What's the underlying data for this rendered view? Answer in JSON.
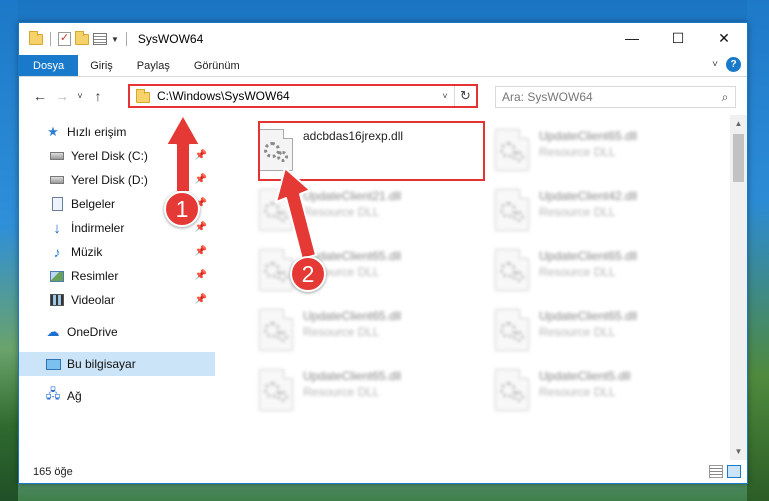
{
  "window": {
    "title": "SysWOW64",
    "controls": {
      "minimize": "—",
      "maximize": "☐",
      "close": "✕"
    }
  },
  "ribbon": {
    "tabs": [
      {
        "label": "Dosya",
        "active": true
      },
      {
        "label": "Giriş"
      },
      {
        "label": "Paylaş"
      },
      {
        "label": "Görünüm"
      }
    ],
    "help_label": "?"
  },
  "navigation": {
    "back_icon": "←",
    "forward_icon": "→",
    "recent_icon": "˅",
    "up_icon": "↑",
    "address_path": "C:\\Windows\\SysWOW64",
    "search_placeholder": "Ara: SysWOW64"
  },
  "sidebar": {
    "items": [
      {
        "label": "Hızlı erişim",
        "icon": "star-icon",
        "pinned": false
      },
      {
        "label": "Yerel Disk (C:)",
        "icon": "drive-icon",
        "pinned": true
      },
      {
        "label": "Yerel Disk (D:)",
        "icon": "drive-icon",
        "pinned": true
      },
      {
        "label": "Belgeler",
        "icon": "document-icon",
        "pinned": true
      },
      {
        "label": "İndirmeler",
        "icon": "download-icon",
        "pinned": true
      },
      {
        "label": "Müzik",
        "icon": "music-icon",
        "pinned": true
      },
      {
        "label": "Resimler",
        "icon": "pictures-icon",
        "pinned": true
      },
      {
        "label": "Videolar",
        "icon": "videos-icon",
        "pinned": true
      },
      {
        "label": "OneDrive",
        "icon": "cloud-icon",
        "pinned": false
      },
      {
        "label": "Bu bilgisayar",
        "icon": "computer-icon",
        "pinned": false,
        "selected": true
      },
      {
        "label": "Ağ",
        "icon": "network-icon",
        "pinned": false
      }
    ]
  },
  "files": [
    {
      "name": "adcbdas16jrexp.dll",
      "type": ""
    },
    {
      "name": "UpdateClient65.dll",
      "type": "Resource DLL"
    },
    {
      "name": "UpdateClient21.dll",
      "type": "Resource DLL"
    },
    {
      "name": "UpdateClient42.dll",
      "type": "Resource DLL"
    },
    {
      "name": "UpdateClient65.dll",
      "type": "Resource DLL"
    },
    {
      "name": "UpdateClient65.dll",
      "type": "Resource DLL"
    },
    {
      "name": "UpdateClient65.dll",
      "type": "Resource DLL"
    },
    {
      "name": "UpdateClient65.dll",
      "type": "Resource DLL"
    },
    {
      "name": "UpdateClient65.dll",
      "type": "Resource DLL"
    },
    {
      "name": "UpdateClient5.dll",
      "type": "Resource DLL"
    }
  ],
  "status": {
    "item_count": "165 öğe"
  },
  "annotations": {
    "step1": "1",
    "step2": "2",
    "color": "#e53935"
  },
  "colors": {
    "accent": "#1979ca",
    "highlight": "#e53333",
    "selection": "#cce4f7"
  }
}
